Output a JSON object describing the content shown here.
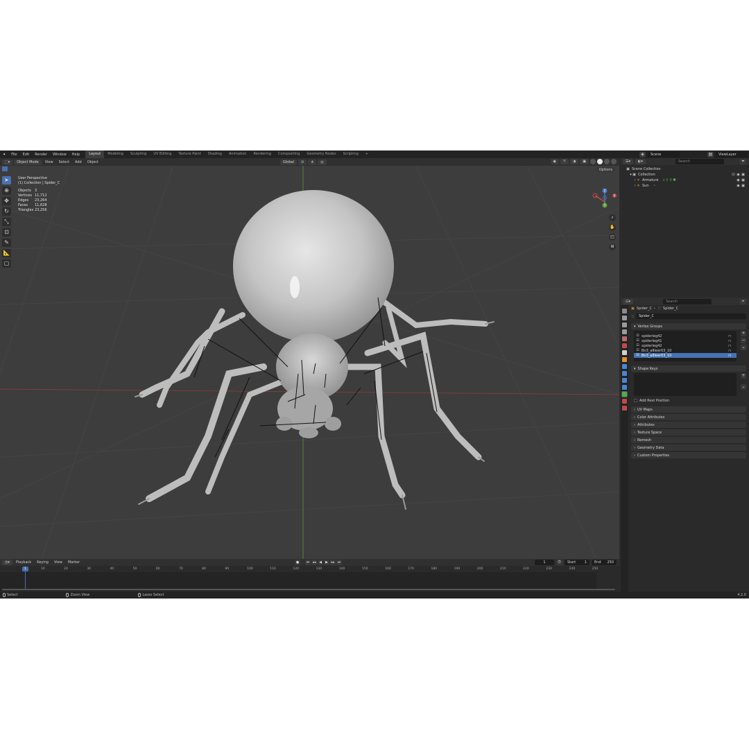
{
  "menu": [
    "File",
    "Edit",
    "Render",
    "Window",
    "Help"
  ],
  "workspaces": [
    "Layout",
    "Modeling",
    "Sculpting",
    "UV Editing",
    "Texture Paint",
    "Shading",
    "Animation",
    "Rendering",
    "Compositing",
    "Geometry Nodes",
    "Scripting"
  ],
  "active_workspace": "Layout",
  "scene": {
    "name": "Scene",
    "view_layer": "ViewLayer"
  },
  "viewport_header": {
    "mode": "Object Mode",
    "menus": [
      "View",
      "Select",
      "Add",
      "Object"
    ],
    "transform": "Global",
    "options": "Options"
  },
  "overlay": {
    "perspective": "User Perspective",
    "collection": "(1) Collection | Spider_C",
    "stats": [
      {
        "label": "Objects",
        "value": "3"
      },
      {
        "label": "Vertices",
        "value": "11,712"
      },
      {
        "label": "Edges",
        "value": "23,264"
      },
      {
        "label": "Faces",
        "value": "11,628"
      },
      {
        "label": "Triangles",
        "value": "23,256"
      }
    ]
  },
  "gizmo": {
    "z": "Z",
    "y": "Y",
    "x": "X"
  },
  "timeline": {
    "menus": [
      "Playback",
      "Keying",
      "View",
      "Marker"
    ],
    "current_frame": "1",
    "start_label": "Start",
    "start": "1",
    "end_label": "End",
    "end": "250",
    "ticks": [
      "1",
      "10",
      "20",
      "30",
      "40",
      "50",
      "60",
      "70",
      "80",
      "90",
      "100",
      "110",
      "120",
      "130",
      "140",
      "150",
      "160",
      "170",
      "180",
      "190",
      "200",
      "210",
      "220",
      "230",
      "240",
      "250"
    ]
  },
  "status": {
    "select": "Select",
    "zoom": "Zoom View",
    "lasso": "Lasso Select",
    "version": "4.2.0"
  },
  "outliner": {
    "search_placeholder": "Search",
    "root": "Scene Collection",
    "collection": "Collection",
    "items": [
      "Armature",
      "Sun"
    ]
  },
  "properties": {
    "search_placeholder": "Search",
    "breadcrumb_object": "Spider_C",
    "breadcrumb_mesh": "Spider_C",
    "mesh_name": "Spider_C",
    "vertex_groups_title": "Vertex Groups",
    "vertex_groups": [
      "spiderleg42",
      "spiderleg41",
      "spiderleg42",
      "Bn3_a8leer03_10",
      "Bn3_a8leer03_10"
    ],
    "selected_index": 4,
    "shape_keys_title": "Shape Keys",
    "add_rest_position": "Add Rest Position",
    "panels": [
      "UV Maps",
      "Color Attributes",
      "Attributes",
      "Texture Space",
      "Remesh",
      "Geometry Data",
      "Custom Properties"
    ]
  }
}
